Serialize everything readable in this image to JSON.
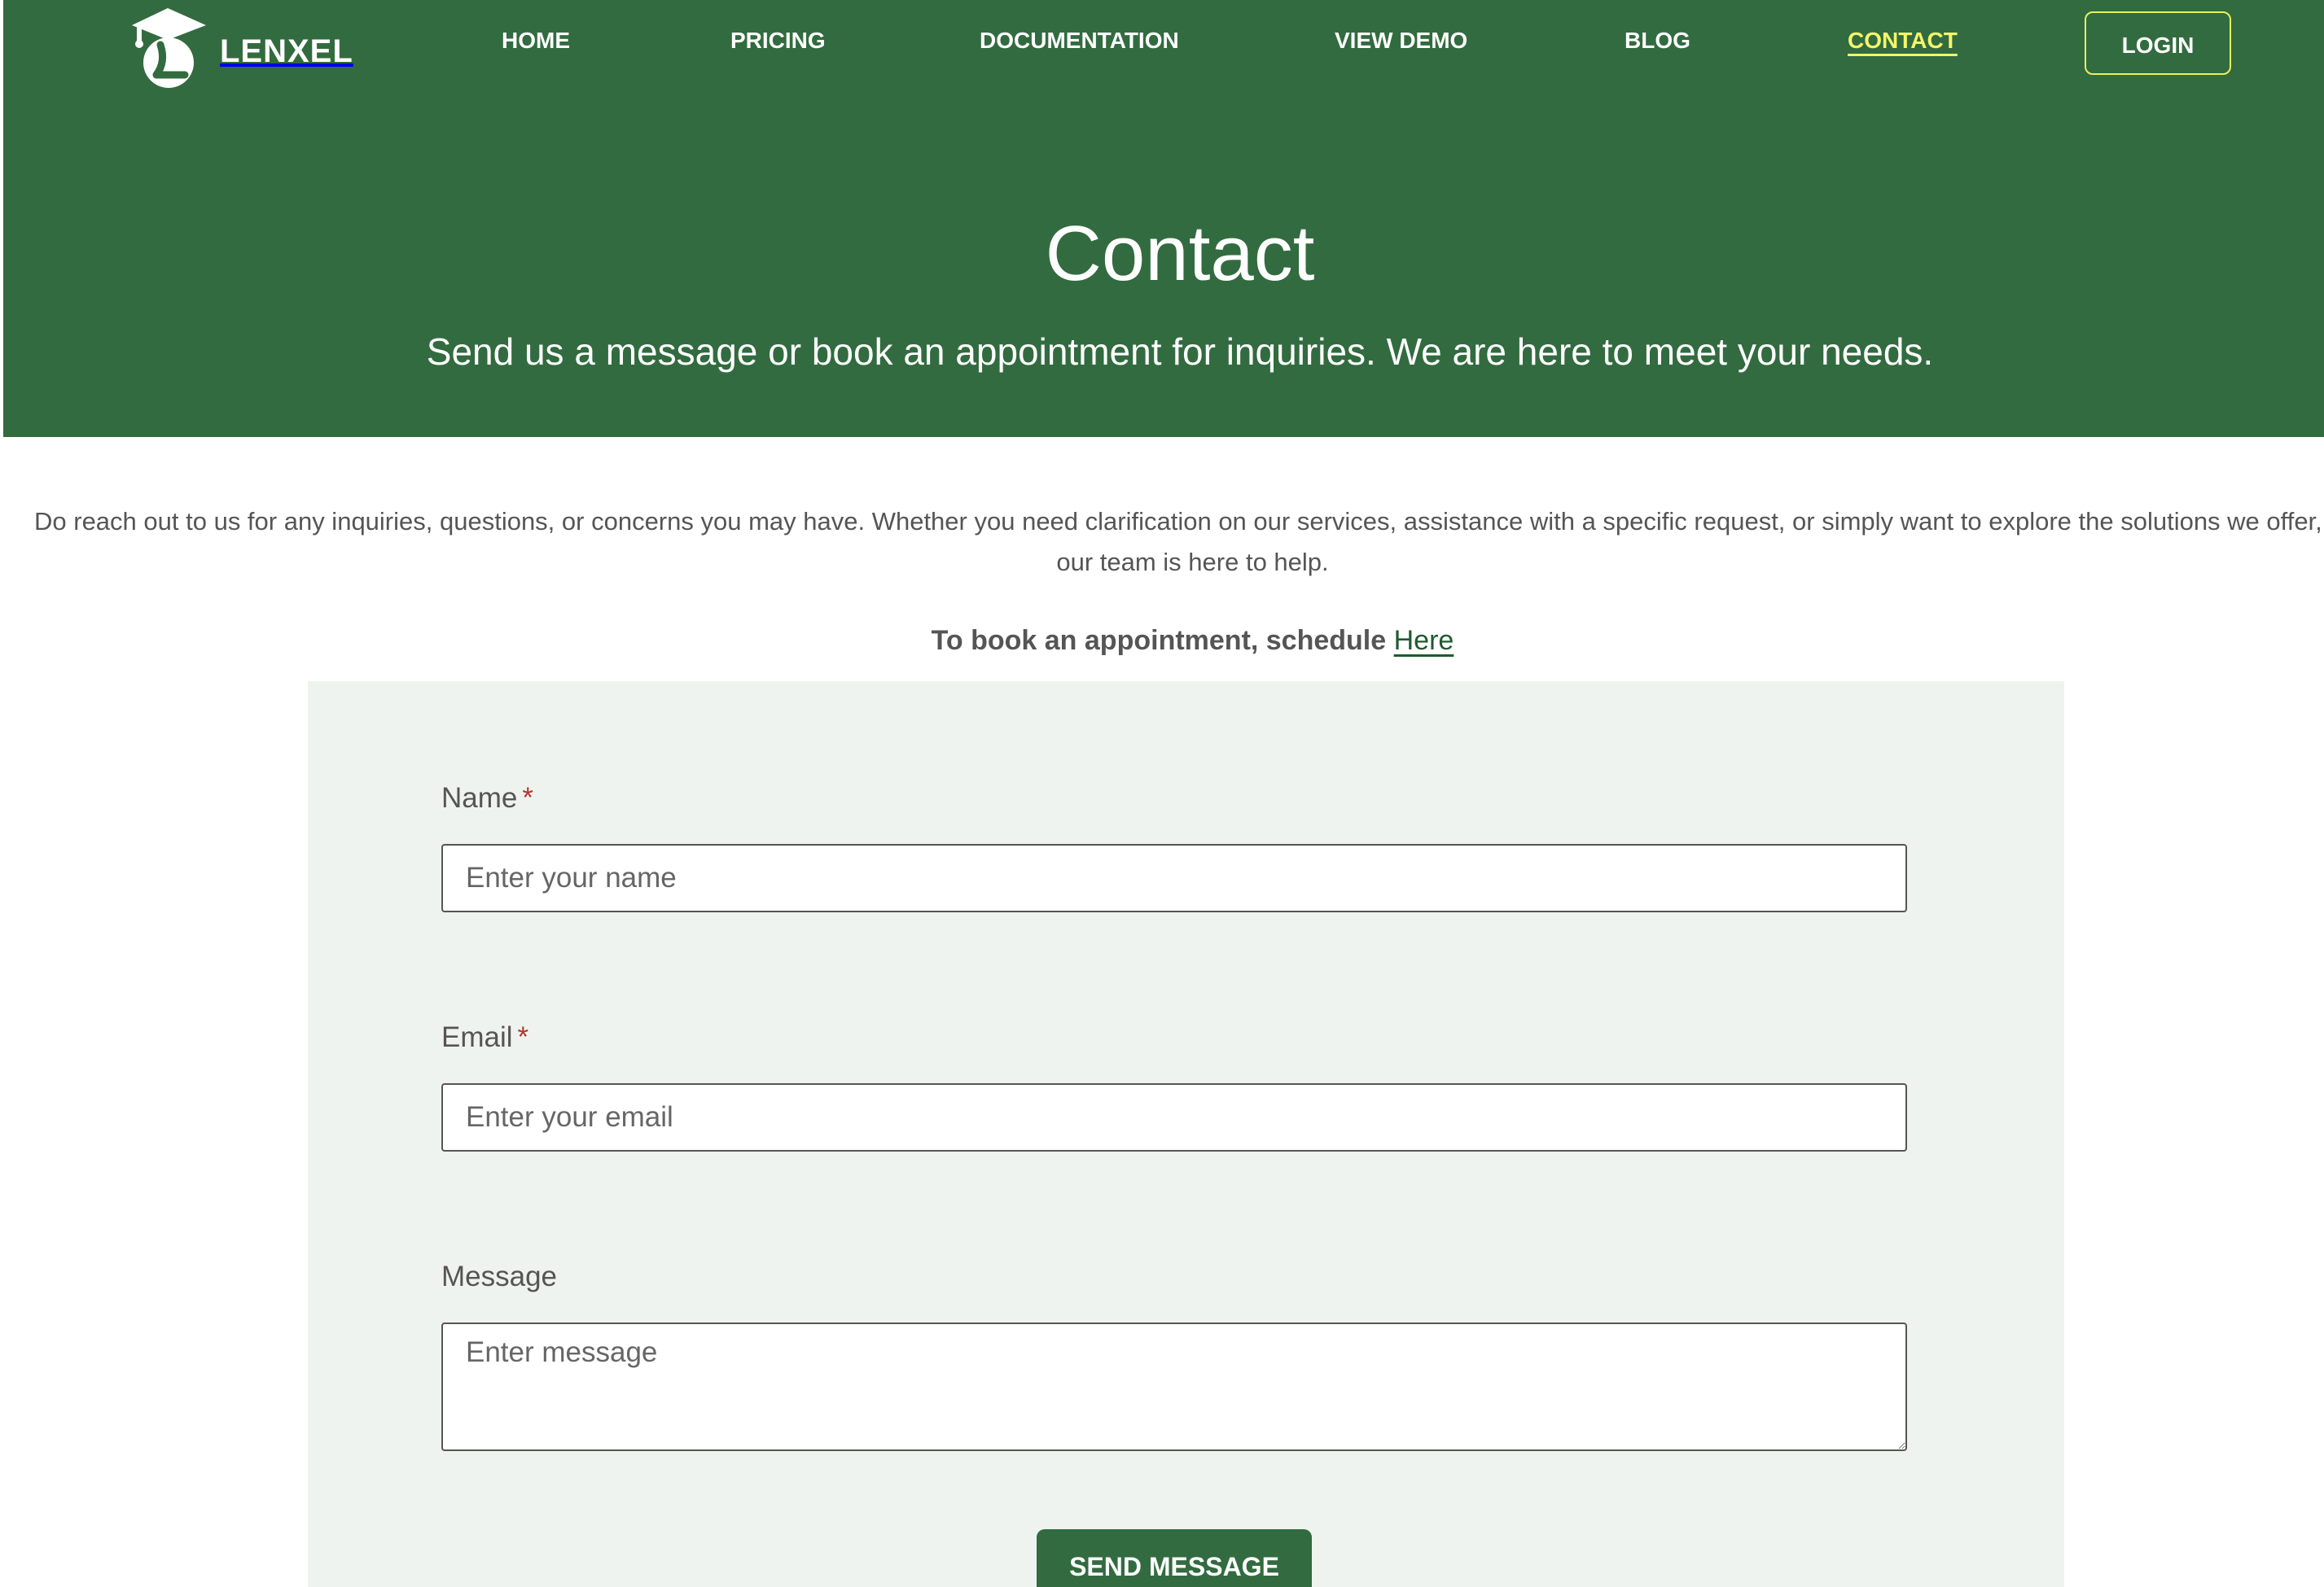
{
  "brand": {
    "name": "LENXEL",
    "logo_icon": "graduation-cap-l-icon"
  },
  "nav": {
    "items": [
      {
        "label": "HOME"
      },
      {
        "label": "PRICING"
      },
      {
        "label": "DOCUMENTATION"
      },
      {
        "label": "VIEW DEMO"
      },
      {
        "label": "BLOG"
      },
      {
        "label": "CONTACT",
        "active": true
      }
    ],
    "login_label": "LOGIN"
  },
  "hero": {
    "title": "Contact",
    "subtitle": "Send us a message or book an appointment for inquiries. We are here to meet your needs."
  },
  "intro": {
    "line1": "Do reach out to us for any inquiries, questions, or concerns you may have. Whether you need clarification on our services, assistance with a specific request, or simply want to explore the solutions we offer,",
    "line2": "our team is here to help."
  },
  "booking": {
    "text": "To book an appointment, schedule",
    "link_label": "Here"
  },
  "form": {
    "name": {
      "label": "Name",
      "required_mark": "*",
      "placeholder": "Enter your name",
      "value": ""
    },
    "email": {
      "label": "Email",
      "required_mark": "*",
      "placeholder": "Enter your email",
      "value": ""
    },
    "message": {
      "label": "Message",
      "placeholder": "Enter message",
      "value": ""
    },
    "submit_label": "SEND MESSAGE"
  },
  "colors": {
    "brand_green": "#326b3f",
    "active_nav": "#f4f56a",
    "form_background": "#eff3ef",
    "required_red": "#b3362c"
  }
}
